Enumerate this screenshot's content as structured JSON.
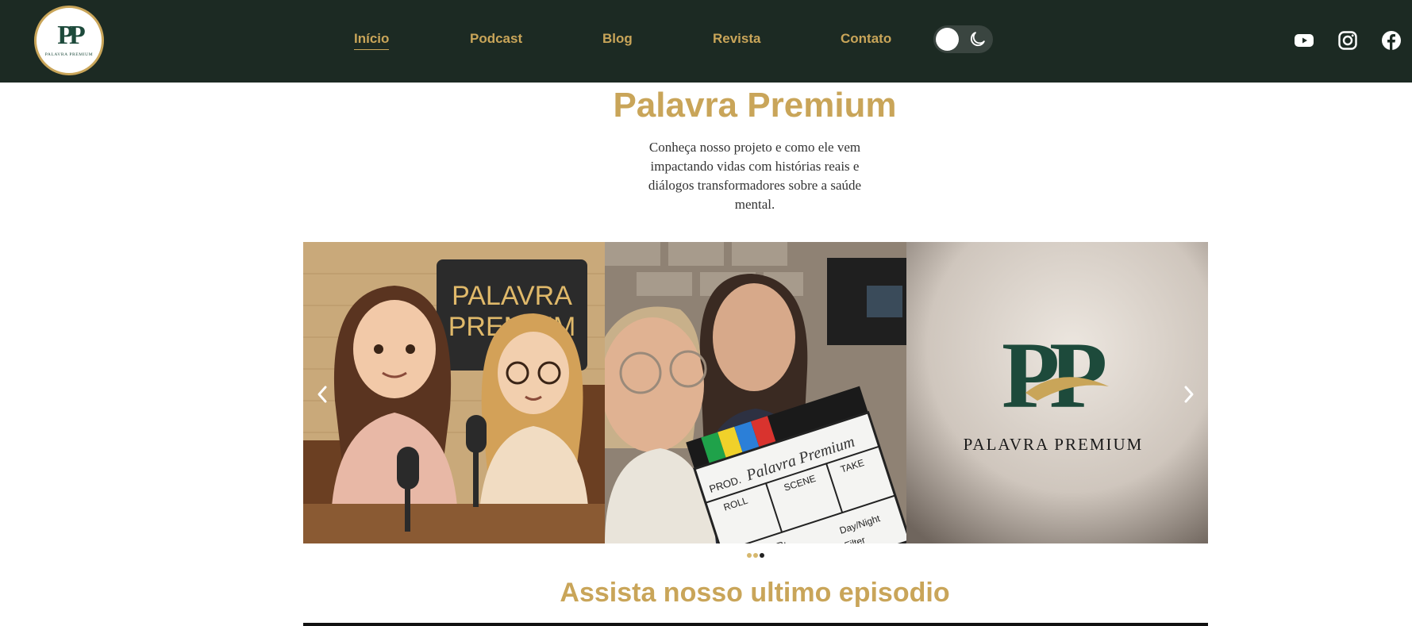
{
  "header": {
    "logo": {
      "monogram": "PP",
      "text": "PALAVRA PREMIUM"
    },
    "nav": [
      {
        "label": "Início",
        "active": true
      },
      {
        "label": "Podcast",
        "active": false
      },
      {
        "label": "Blog",
        "active": false
      },
      {
        "label": "Revista",
        "active": false
      },
      {
        "label": "Contato",
        "active": false
      }
    ],
    "theme_toggle": {
      "state": "light",
      "icon": "moon-icon"
    },
    "social": [
      "youtube-icon",
      "instagram-icon",
      "facebook-icon"
    ]
  },
  "hero": {
    "title": "Palavra Premium",
    "description": "Conheça nosso projeto e como ele vem impactando vidas com histórias reais e diálogos transformadores sobre a saúde mental."
  },
  "carousel": {
    "slides": [
      {
        "sign_text": "PALAVRA PREMIUM"
      },
      {
        "clapper_text": "Palavra Premium"
      },
      {
        "logo_text": "PALAVRA PREMIUM"
      }
    ],
    "slide_count": 3,
    "active_index": 2
  },
  "episode_section": {
    "title": "Assista nosso ultimo episodio"
  },
  "colors": {
    "header_bg": "#1c2a23",
    "accent_gold": "#c9a559",
    "brand_green": "#1d4a3b"
  }
}
